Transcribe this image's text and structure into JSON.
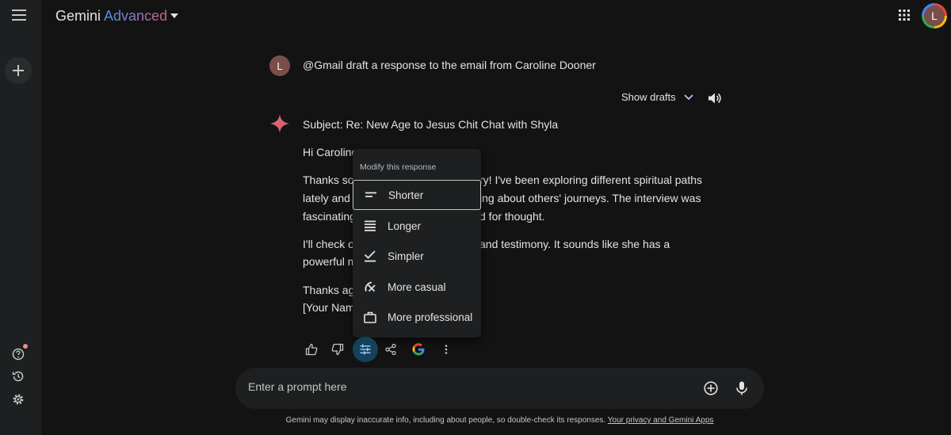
{
  "app": {
    "name": "Gemini",
    "tier": "Advanced",
    "user_initial": "L"
  },
  "conversation": {
    "user_initial": "L",
    "user_prompt": "@Gmail draft a response to the email from Caroline Dooner",
    "show_drafts_label": "Show drafts",
    "response": {
      "subject": "Subject: Re: New Age to Jesus Chit Chat with Shyla",
      "visible_lines": [
        "Hi Caroline",
        "Thanks so",
        "ry! I've been exploring different spiritual paths",
        "lately and I",
        "ing about others' journeys. The interview was",
        "fascinating",
        "d for thought.",
        "I'll check o",
        "and testimony. It sounds like she has a",
        "powerful m",
        "Thanks aga",
        "[Your Name"
      ]
    }
  },
  "modify_menu": {
    "heading": "Modify this response",
    "items": [
      {
        "label": "Shorter",
        "icon": "short-text-icon",
        "selected": true
      },
      {
        "label": "Longer",
        "icon": "long-text-icon",
        "selected": false
      },
      {
        "label": "Simpler",
        "icon": "check-line-icon",
        "selected": false
      },
      {
        "label": "More casual",
        "icon": "casual-icon",
        "selected": false
      },
      {
        "label": "More professional",
        "icon": "briefcase-icon",
        "selected": false
      }
    ]
  },
  "actions": [
    "thumb-up-icon",
    "thumb-down-icon",
    "tune-icon",
    "share-icon",
    "google-icon",
    "more-vert-icon"
  ],
  "prompt": {
    "placeholder": "Enter a prompt here"
  },
  "footer": {
    "text": "Gemini may display inaccurate info, including about people, so double-check its responses.",
    "link": "Your privacy and Gemini Apps"
  },
  "colors": {
    "background": "#131314",
    "surface": "#1e1f20",
    "text": "#e3e3e3",
    "active_action": "#12425c",
    "avatar": "#7a4e48"
  }
}
